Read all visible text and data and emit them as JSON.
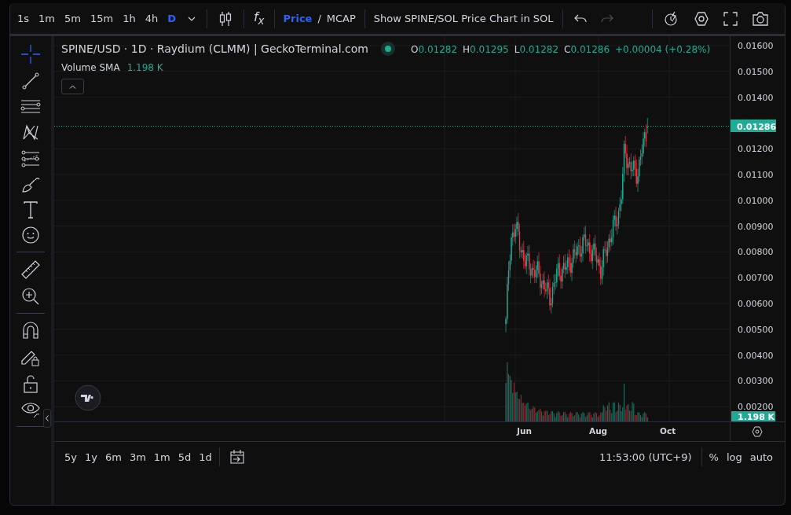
{
  "toolbar": {
    "intervals": [
      {
        "label": "1s",
        "selected": false
      },
      {
        "label": "1m",
        "selected": false
      },
      {
        "label": "5m",
        "selected": false
      },
      {
        "label": "15m",
        "selected": false
      },
      {
        "label": "1h",
        "selected": false
      },
      {
        "label": "4h",
        "selected": false
      },
      {
        "label": "D",
        "selected": true
      }
    ],
    "indicators_label": "f$_{x}$",
    "price_mode": [
      {
        "label": "Price",
        "selected": true
      },
      {
        "label": "MCAP",
        "selected": false
      }
    ],
    "mode_separator": "/",
    "quote_toggle": "Show SPINE/SOL Price Chart in SOL",
    "redo_disabled": true
  },
  "legend": {
    "title": "SPINE/USD · 1D · Raydium (CLMM) | GeckoTerminal.com",
    "ohlc": [
      {
        "key": "O",
        "value": "0.01282"
      },
      {
        "key": "H",
        "value": "0.01295"
      },
      {
        "key": "L",
        "value": "0.01282"
      },
      {
        "key": "C",
        "value": "0.01286"
      }
    ],
    "change": "+0.00004 (+0.28%)",
    "volume_label": "Volume SMA",
    "volume_value": "1.198 K"
  },
  "price_axis": {
    "ticks": [
      "0.01600",
      "0.01500",
      "0.01400",
      "0.01200",
      "0.01100",
      "0.01000",
      "0.00900",
      "0.00800",
      "0.00700",
      "0.00600",
      "0.00500",
      "0.00400",
      "0.00300",
      "0.00200"
    ],
    "last_price": "0.01286",
    "volume_last": "1.198 K"
  },
  "time_axis": {
    "labels": [
      "Jun",
      "Aug",
      "Oct"
    ]
  },
  "bottom_bar": {
    "ranges": [
      "5y",
      "1y",
      "6m",
      "3m",
      "1m",
      "5d",
      "1d"
    ],
    "time": "11:53:00 (UTC+9)",
    "scale_options": [
      "%",
      "log",
      "auto"
    ]
  }
}
